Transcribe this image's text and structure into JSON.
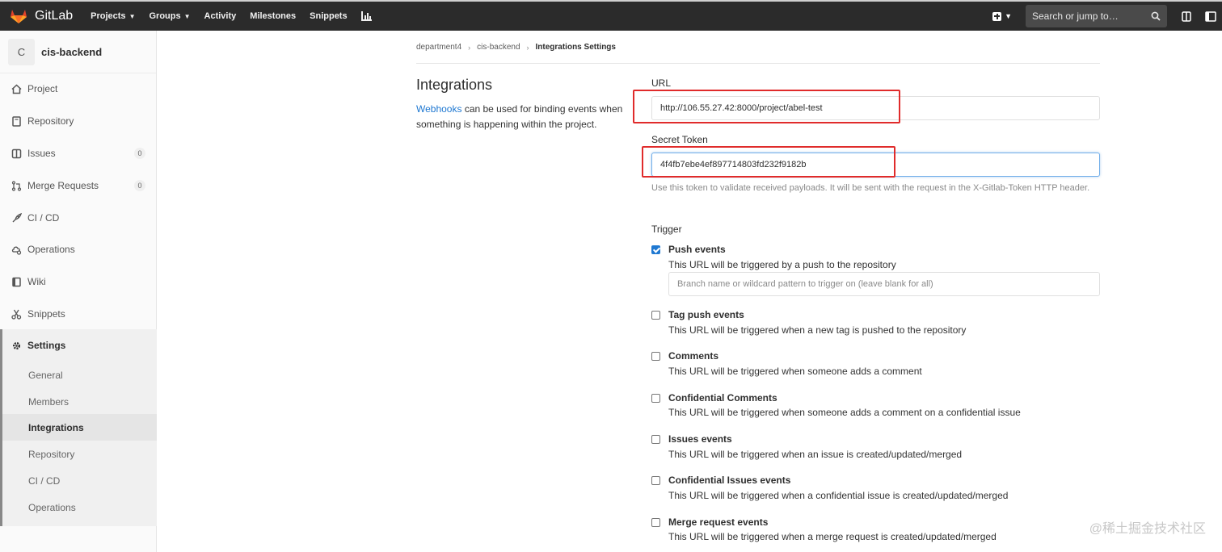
{
  "navbar": {
    "brand": "GitLab",
    "links": [
      {
        "label": "Projects",
        "dropdown": true
      },
      {
        "label": "Groups",
        "dropdown": true
      },
      {
        "label": "Activity",
        "dropdown": false
      },
      {
        "label": "Milestones",
        "dropdown": false
      },
      {
        "label": "Snippets",
        "dropdown": false
      }
    ],
    "search_placeholder": "Search or jump to…",
    "colors": {
      "bg": "#2b2b2b",
      "logo": "#e24329"
    }
  },
  "sidebar": {
    "avatar_letter": "C",
    "project_name": "cis-backend",
    "items": [
      {
        "label": "Project",
        "icon": "home-icon"
      },
      {
        "label": "Repository",
        "icon": "book-icon"
      },
      {
        "label": "Issues",
        "icon": "issues-icon",
        "count": "0"
      },
      {
        "label": "Merge Requests",
        "icon": "merge-request-icon",
        "count": "0"
      },
      {
        "label": "CI / CD",
        "icon": "rocket-icon"
      },
      {
        "label": "Operations",
        "icon": "cloud-gear-icon"
      },
      {
        "label": "Wiki",
        "icon": "wiki-icon"
      },
      {
        "label": "Snippets",
        "icon": "scissors-icon"
      }
    ],
    "settings": {
      "label": "Settings",
      "icon": "gear-icon",
      "sub_items": [
        "General",
        "Members",
        "Integrations",
        "Repository",
        "CI / CD",
        "Operations"
      ],
      "active": "Integrations"
    }
  },
  "breadcrumb": [
    "department4",
    "cis-backend",
    "Integrations Settings"
  ],
  "section": {
    "title": "Integrations",
    "desc_link": "Webhooks",
    "desc_text": " can be used for binding events when something is happening within the project."
  },
  "form": {
    "url_label": "URL",
    "url_value": "http://106.55.27.42:8000/project/abel-test",
    "token_label": "Secret Token",
    "token_value": "4f4fb7ebe4ef897714803fd232f9182b",
    "token_help": "Use this token to validate received payloads. It will be sent with the request in the X-Gitlab-Token HTTP header.",
    "trigger_label": "Trigger",
    "branch_placeholder": "Branch name or wildcard pattern to trigger on (leave blank for all)",
    "events": [
      {
        "title": "Push events",
        "desc": "This URL will be triggered by a push to the repository",
        "checked": true
      },
      {
        "title": "Tag push events",
        "desc": "This URL will be triggered when a new tag is pushed to the repository",
        "checked": false
      },
      {
        "title": "Comments",
        "desc": "This URL will be triggered when someone adds a comment",
        "checked": false
      },
      {
        "title": "Confidential Comments",
        "desc": "This URL will be triggered when someone adds a comment on a confidential issue",
        "checked": false
      },
      {
        "title": "Issues events",
        "desc": "This URL will be triggered when an issue is created/updated/merged",
        "checked": false
      },
      {
        "title": "Confidential Issues events",
        "desc": "This URL will be triggered when a confidential issue is created/updated/merged",
        "checked": false
      },
      {
        "title": "Merge request events",
        "desc": "This URL will be triggered when a merge request is created/updated/merged",
        "checked": false
      }
    ]
  },
  "watermark": "@稀土掘金技术社区",
  "annotation_color": "#e02b2b"
}
